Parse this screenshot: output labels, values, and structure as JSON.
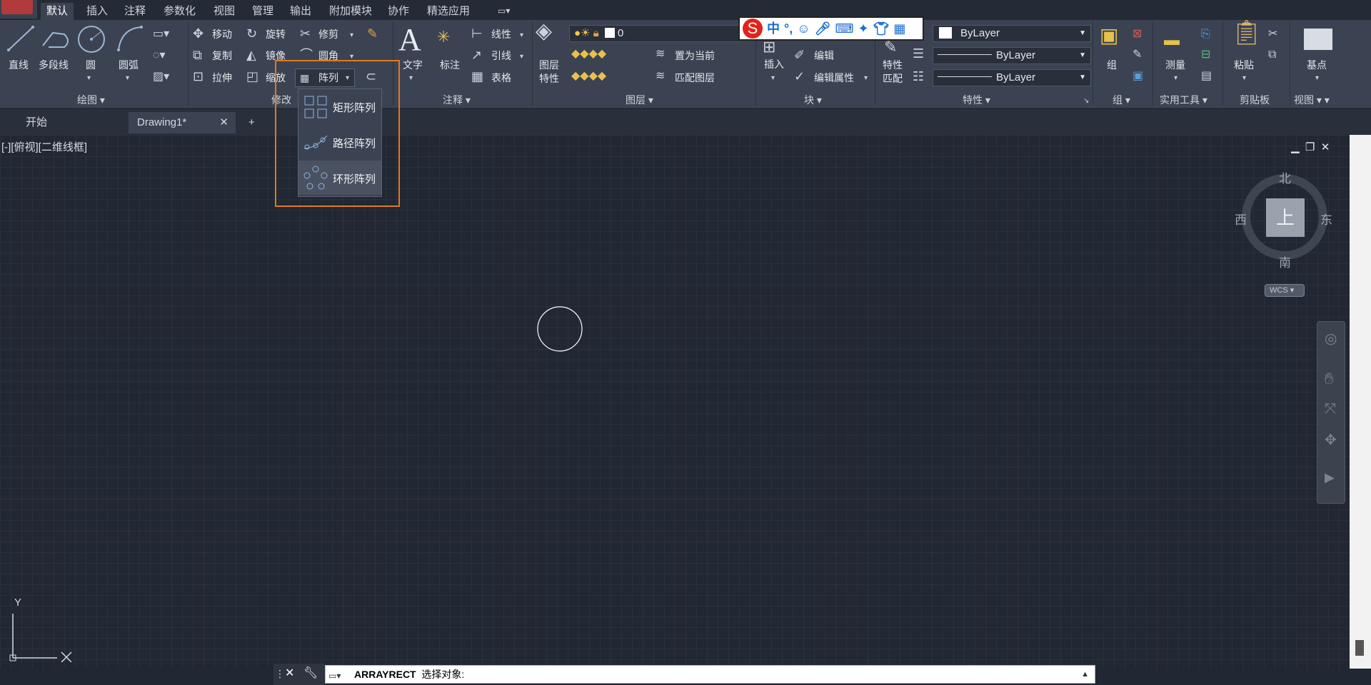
{
  "ribbon_tabs": [
    "默认",
    "插入",
    "注释",
    "参数化",
    "视图",
    "管理",
    "输出",
    "附加模块",
    "协作",
    "精选应用"
  ],
  "draw": {
    "line": "直线",
    "polyline": "多段线",
    "circle": "圆",
    "arc": "圆弧",
    "title": "绘图"
  },
  "modify": {
    "move": "移动",
    "rotate": "旋转",
    "trim": "修剪",
    "copy": "复制",
    "mirror": "镜像",
    "fillet": "圆角",
    "stretch": "拉伸",
    "scale": "缩放",
    "array": "阵列",
    "title": "修改"
  },
  "annotation": {
    "text": "文字",
    "dimension": "标注",
    "linear": "线性",
    "leader": "引线",
    "table": "表格",
    "title": "注释"
  },
  "layers": {
    "properties_line1": "图层",
    "properties_line2": "特性",
    "current_layer": "0",
    "make_current": "置为当前",
    "match_layer": "匹配图层",
    "title": "图层"
  },
  "block": {
    "insert": "插入",
    "edit": "编辑",
    "edit_attributes": "编辑属性",
    "title": "块"
  },
  "properties": {
    "match_line1": "特性",
    "match_line2": "匹配",
    "color": "ByLayer",
    "linetype": "ByLayer",
    "lineweight": "ByLayer",
    "title": "特性"
  },
  "groups": {
    "group": "组",
    "title": "组"
  },
  "utilities": {
    "measure": "测量",
    "title": "实用工具"
  },
  "clipboard": {
    "paste": "粘贴",
    "title": "剪贴板"
  },
  "view": {
    "base": "基点",
    "title": "视图"
  },
  "array_menu": {
    "rect": "矩形阵列",
    "path": "路径阵列",
    "polar": "环形阵列"
  },
  "document_tabs": {
    "start": "开始",
    "drawing": "Drawing1*"
  },
  "viewport_label": "[-][俯视][二维线框]",
  "viewcube": {
    "north": "北",
    "south": "南",
    "east": "东",
    "west": "西",
    "top": "上",
    "wcs": "WCS"
  },
  "ucs": {
    "y": "Y"
  },
  "ime": {
    "lang": "中",
    "punct": "°,"
  },
  "command": {
    "name": "ARRAYRECT",
    "prompt": "选择对象:"
  }
}
